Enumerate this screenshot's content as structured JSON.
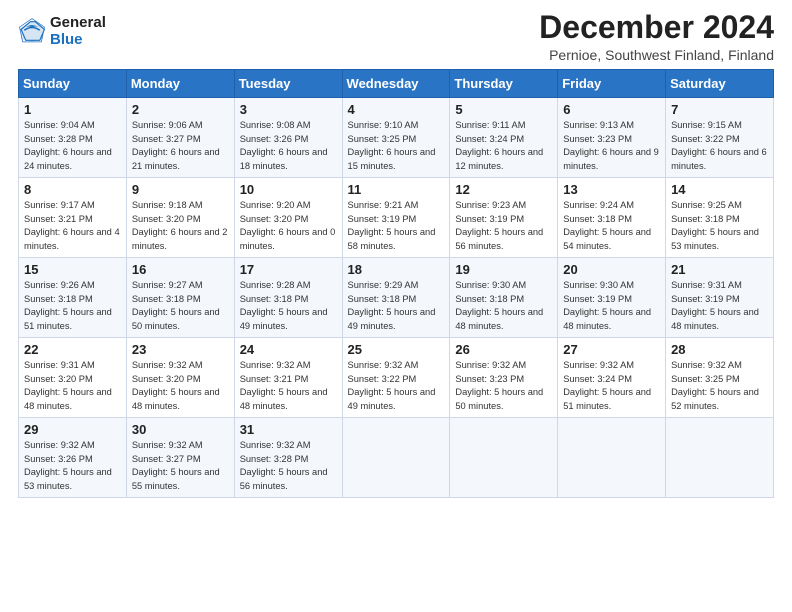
{
  "logo": {
    "general": "General",
    "blue": "Blue"
  },
  "title": "December 2024",
  "subtitle": "Pernioe, Southwest Finland, Finland",
  "header_days": [
    "Sunday",
    "Monday",
    "Tuesday",
    "Wednesday",
    "Thursday",
    "Friday",
    "Saturday"
  ],
  "weeks": [
    [
      {
        "day": "1",
        "sunrise": "Sunrise: 9:04 AM",
        "sunset": "Sunset: 3:28 PM",
        "daylight": "Daylight: 6 hours and 24 minutes."
      },
      {
        "day": "2",
        "sunrise": "Sunrise: 9:06 AM",
        "sunset": "Sunset: 3:27 PM",
        "daylight": "Daylight: 6 hours and 21 minutes."
      },
      {
        "day": "3",
        "sunrise": "Sunrise: 9:08 AM",
        "sunset": "Sunset: 3:26 PM",
        "daylight": "Daylight: 6 hours and 18 minutes."
      },
      {
        "day": "4",
        "sunrise": "Sunrise: 9:10 AM",
        "sunset": "Sunset: 3:25 PM",
        "daylight": "Daylight: 6 hours and 15 minutes."
      },
      {
        "day": "5",
        "sunrise": "Sunrise: 9:11 AM",
        "sunset": "Sunset: 3:24 PM",
        "daylight": "Daylight: 6 hours and 12 minutes."
      },
      {
        "day": "6",
        "sunrise": "Sunrise: 9:13 AM",
        "sunset": "Sunset: 3:23 PM",
        "daylight": "Daylight: 6 hours and 9 minutes."
      },
      {
        "day": "7",
        "sunrise": "Sunrise: 9:15 AM",
        "sunset": "Sunset: 3:22 PM",
        "daylight": "Daylight: 6 hours and 6 minutes."
      }
    ],
    [
      {
        "day": "8",
        "sunrise": "Sunrise: 9:17 AM",
        "sunset": "Sunset: 3:21 PM",
        "daylight": "Daylight: 6 hours and 4 minutes."
      },
      {
        "day": "9",
        "sunrise": "Sunrise: 9:18 AM",
        "sunset": "Sunset: 3:20 PM",
        "daylight": "Daylight: 6 hours and 2 minutes."
      },
      {
        "day": "10",
        "sunrise": "Sunrise: 9:20 AM",
        "sunset": "Sunset: 3:20 PM",
        "daylight": "Daylight: 6 hours and 0 minutes."
      },
      {
        "day": "11",
        "sunrise": "Sunrise: 9:21 AM",
        "sunset": "Sunset: 3:19 PM",
        "daylight": "Daylight: 5 hours and 58 minutes."
      },
      {
        "day": "12",
        "sunrise": "Sunrise: 9:23 AM",
        "sunset": "Sunset: 3:19 PM",
        "daylight": "Daylight: 5 hours and 56 minutes."
      },
      {
        "day": "13",
        "sunrise": "Sunrise: 9:24 AM",
        "sunset": "Sunset: 3:18 PM",
        "daylight": "Daylight: 5 hours and 54 minutes."
      },
      {
        "day": "14",
        "sunrise": "Sunrise: 9:25 AM",
        "sunset": "Sunset: 3:18 PM",
        "daylight": "Daylight: 5 hours and 53 minutes."
      }
    ],
    [
      {
        "day": "15",
        "sunrise": "Sunrise: 9:26 AM",
        "sunset": "Sunset: 3:18 PM",
        "daylight": "Daylight: 5 hours and 51 minutes."
      },
      {
        "day": "16",
        "sunrise": "Sunrise: 9:27 AM",
        "sunset": "Sunset: 3:18 PM",
        "daylight": "Daylight: 5 hours and 50 minutes."
      },
      {
        "day": "17",
        "sunrise": "Sunrise: 9:28 AM",
        "sunset": "Sunset: 3:18 PM",
        "daylight": "Daylight: 5 hours and 49 minutes."
      },
      {
        "day": "18",
        "sunrise": "Sunrise: 9:29 AM",
        "sunset": "Sunset: 3:18 PM",
        "daylight": "Daylight: 5 hours and 49 minutes."
      },
      {
        "day": "19",
        "sunrise": "Sunrise: 9:30 AM",
        "sunset": "Sunset: 3:18 PM",
        "daylight": "Daylight: 5 hours and 48 minutes."
      },
      {
        "day": "20",
        "sunrise": "Sunrise: 9:30 AM",
        "sunset": "Sunset: 3:19 PM",
        "daylight": "Daylight: 5 hours and 48 minutes."
      },
      {
        "day": "21",
        "sunrise": "Sunrise: 9:31 AM",
        "sunset": "Sunset: 3:19 PM",
        "daylight": "Daylight: 5 hours and 48 minutes."
      }
    ],
    [
      {
        "day": "22",
        "sunrise": "Sunrise: 9:31 AM",
        "sunset": "Sunset: 3:20 PM",
        "daylight": "Daylight: 5 hours and 48 minutes."
      },
      {
        "day": "23",
        "sunrise": "Sunrise: 9:32 AM",
        "sunset": "Sunset: 3:20 PM",
        "daylight": "Daylight: 5 hours and 48 minutes."
      },
      {
        "day": "24",
        "sunrise": "Sunrise: 9:32 AM",
        "sunset": "Sunset: 3:21 PM",
        "daylight": "Daylight: 5 hours and 48 minutes."
      },
      {
        "day": "25",
        "sunrise": "Sunrise: 9:32 AM",
        "sunset": "Sunset: 3:22 PM",
        "daylight": "Daylight: 5 hours and 49 minutes."
      },
      {
        "day": "26",
        "sunrise": "Sunrise: 9:32 AM",
        "sunset": "Sunset: 3:23 PM",
        "daylight": "Daylight: 5 hours and 50 minutes."
      },
      {
        "day": "27",
        "sunrise": "Sunrise: 9:32 AM",
        "sunset": "Sunset: 3:24 PM",
        "daylight": "Daylight: 5 hours and 51 minutes."
      },
      {
        "day": "28",
        "sunrise": "Sunrise: 9:32 AM",
        "sunset": "Sunset: 3:25 PM",
        "daylight": "Daylight: 5 hours and 52 minutes."
      }
    ],
    [
      {
        "day": "29",
        "sunrise": "Sunrise: 9:32 AM",
        "sunset": "Sunset: 3:26 PM",
        "daylight": "Daylight: 5 hours and 53 minutes."
      },
      {
        "day": "30",
        "sunrise": "Sunrise: 9:32 AM",
        "sunset": "Sunset: 3:27 PM",
        "daylight": "Daylight: 5 hours and 55 minutes."
      },
      {
        "day": "31",
        "sunrise": "Sunrise: 9:32 AM",
        "sunset": "Sunset: 3:28 PM",
        "daylight": "Daylight: 5 hours and 56 minutes."
      },
      null,
      null,
      null,
      null
    ]
  ]
}
